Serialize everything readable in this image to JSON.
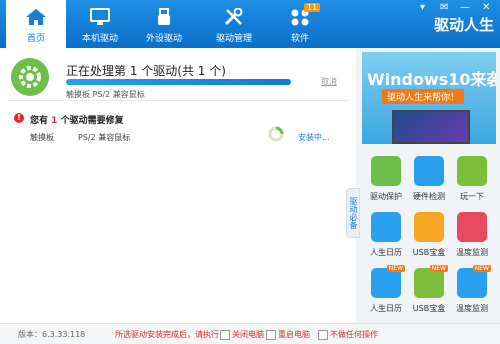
{
  "nav": {
    "items": [
      {
        "label": "首页",
        "icon": "home-icon",
        "active": true
      },
      {
        "label": "本机驱动",
        "icon": "monitor-icon",
        "active": false
      },
      {
        "label": "外设驱动",
        "icon": "usb-icon",
        "active": false
      },
      {
        "label": "驱动管理",
        "icon": "tools-icon",
        "active": false
      },
      {
        "label": "软件",
        "icon": "apps-icon",
        "active": false,
        "badge": "11"
      }
    ],
    "brand": "驱动人生"
  },
  "processing": {
    "title": "正在处理第 1 个驱动(共 1 个)",
    "progress": 1.0,
    "cancel": "取消",
    "subtitle": "触摸板 PS/2 兼容鼠标"
  },
  "alert": {
    "prefix": "您有",
    "count": "1",
    "suffix": "个驱动需要修复"
  },
  "driver_row": {
    "category": "触摸板",
    "device": "PS/2 兼容鼠标",
    "status": "安装中..."
  },
  "side": {
    "tab_label": "驱动必备",
    "ad": {
      "title": "Windows10来袭",
      "subtitle": "驱动人生来帮你！"
    },
    "tiles": [
      {
        "label": "驱动保护",
        "icon": "driver-protect-icon",
        "color": "#6cc04a",
        "new": false
      },
      {
        "label": "硬件检测",
        "icon": "hardware-detect-icon",
        "color": "#2a9ff0",
        "new": false
      },
      {
        "label": "玩一下",
        "icon": "gamepad-icon",
        "color": "#7cbf3a",
        "new": false
      },
      {
        "label": "人生日历",
        "icon": "calendar-icon",
        "color": "#2a9ff0",
        "new": false
      },
      {
        "label": "USB宝盒",
        "icon": "usb-box-icon",
        "color": "#f5a623",
        "new": false
      },
      {
        "label": "温度监测",
        "icon": "thermometer-icon",
        "color": "#e84b5f",
        "new": false
      },
      {
        "label": "人生日历",
        "icon": "calendar-icon",
        "color": "#2a9ff0",
        "new": true
      },
      {
        "label": "USB宝盒",
        "icon": "usb-box-icon",
        "color": "#7cbf3a",
        "new": true
      },
      {
        "label": "温度监测",
        "icon": "thermometer-icon",
        "color": "#2a9ff0",
        "new": true
      }
    ],
    "new_label": "NEW"
  },
  "footer": {
    "version": "版本：6.3.33.118",
    "option_text": "所选驱动安装完成后，请执行",
    "shutdown": "关闭电脑",
    "restart": "重启电脑",
    "other": "不做任何操作"
  },
  "colors": {
    "accent": "#1a7fd3",
    "header": "#0c6fc8",
    "alert": "#e02a2a",
    "green": "#6cc04a"
  }
}
